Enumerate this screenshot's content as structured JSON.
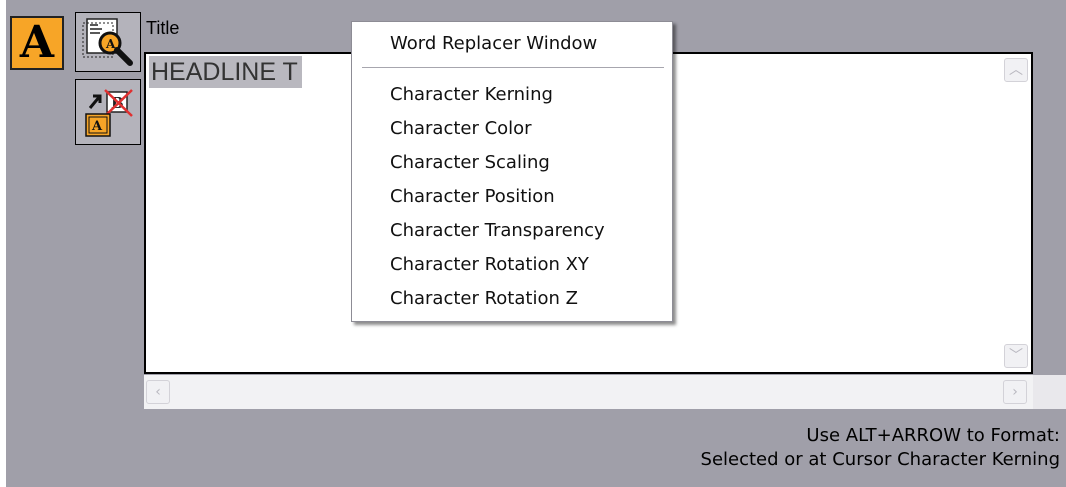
{
  "editor": {
    "title_label": "Title",
    "visible_text": "HEADLINE T"
  },
  "toolbar": {
    "text_tool_glyph": "A",
    "icons": [
      "text-format-icon",
      "find-text-icon",
      "word-replace-icon"
    ]
  },
  "context_menu": {
    "items": [
      "Word Replacer Window",
      "Character Kerning",
      "Character Color",
      "Character Scaling",
      "Character Position",
      "Character Transparency",
      "Character Rotation XY",
      "Character Rotation Z"
    ]
  },
  "hint": {
    "line1": "Use ALT+ARROW to Format:",
    "line2": "Selected or at Cursor Character Kerning"
  },
  "colors": {
    "panel_background": "#a09fa9",
    "text_tool_accent": "#f7a527",
    "selection_highlight": "#b9b8bf"
  }
}
